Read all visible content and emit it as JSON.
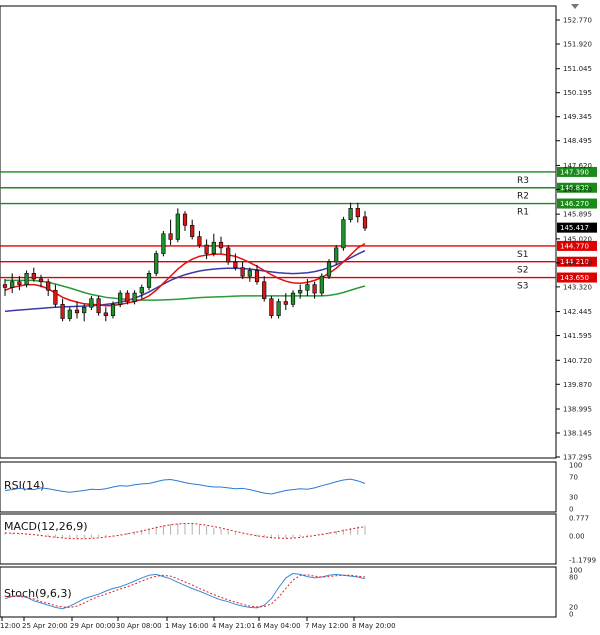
{
  "chart_data": {
    "type": "candlestick",
    "price_axis_labels": [
      "152.770",
      "151.920",
      "151.045",
      "150.195",
      "149.345",
      "148.495",
      "147.620",
      "146.770",
      "145.895",
      "145.020",
      "144.170",
      "143.320",
      "142.445",
      "141.595",
      "140.720",
      "139.870",
      "138.995",
      "138.145",
      "137.295"
    ],
    "price_range": [
      137.295,
      152.77
    ],
    "current_price": "145.417",
    "time_labels": [
      "12:00",
      "25 Apr 20:00",
      "29 Apr 00:00",
      "30 Apr 08:00",
      "1 May 16:00",
      "4 May 21:01",
      "6 May 04:00",
      "7 May 12:00",
      "8 May 20:00"
    ],
    "candles": [
      [
        143.4,
        143.6,
        143.0,
        143.3
      ],
      [
        143.3,
        143.8,
        143.1,
        143.5
      ],
      [
        143.5,
        143.7,
        143.2,
        143.4
      ],
      [
        143.4,
        143.9,
        143.3,
        143.8
      ],
      [
        143.8,
        144.0,
        143.5,
        143.6
      ],
      [
        143.6,
        143.75,
        143.3,
        143.5
      ],
      [
        143.5,
        143.6,
        143.0,
        143.2
      ],
      [
        143.2,
        143.4,
        142.6,
        142.7
      ],
      [
        142.7,
        142.9,
        142.1,
        142.2
      ],
      [
        142.2,
        142.6,
        142.1,
        142.5
      ],
      [
        142.5,
        142.8,
        142.2,
        142.4
      ],
      [
        142.4,
        142.7,
        142.1,
        142.6
      ],
      [
        142.6,
        143.0,
        142.5,
        142.9
      ],
      [
        142.9,
        143.0,
        142.3,
        142.4
      ],
      [
        142.4,
        142.6,
        142.1,
        142.3
      ],
      [
        142.3,
        142.8,
        142.2,
        142.7
      ],
      [
        142.7,
        143.2,
        142.6,
        143.1
      ],
      [
        143.1,
        143.2,
        142.7,
        142.8
      ],
      [
        142.8,
        143.2,
        142.7,
        143.1
      ],
      [
        143.1,
        143.4,
        142.9,
        143.3
      ],
      [
        143.3,
        143.9,
        143.2,
        143.8
      ],
      [
        143.8,
        144.6,
        143.7,
        144.5
      ],
      [
        144.5,
        145.3,
        144.4,
        145.2
      ],
      [
        145.2,
        145.7,
        144.8,
        145.0
      ],
      [
        145.0,
        146.1,
        144.9,
        145.9
      ],
      [
        145.9,
        146.0,
        145.3,
        145.5
      ],
      [
        145.5,
        145.7,
        145.0,
        145.1
      ],
      [
        145.1,
        145.3,
        144.7,
        144.8
      ],
      [
        144.8,
        145.0,
        144.3,
        144.5
      ],
      [
        144.5,
        145.2,
        144.4,
        144.9
      ],
      [
        144.9,
        145.1,
        144.5,
        144.7
      ],
      [
        144.7,
        144.8,
        144.1,
        144.2
      ],
      [
        144.2,
        144.5,
        143.9,
        144.0
      ],
      [
        144.0,
        144.2,
        143.6,
        143.7
      ],
      [
        143.7,
        144.0,
        143.5,
        143.9
      ],
      [
        143.9,
        144.1,
        143.4,
        143.5
      ],
      [
        143.5,
        143.7,
        142.8,
        142.9
      ],
      [
        142.9,
        143.0,
        142.2,
        142.3
      ],
      [
        142.3,
        142.9,
        142.2,
        142.8
      ],
      [
        142.8,
        143.1,
        142.5,
        142.7
      ],
      [
        142.7,
        143.2,
        142.6,
        143.1
      ],
      [
        143.1,
        143.4,
        142.9,
        143.2
      ],
      [
        143.2,
        143.6,
        143.0,
        143.4
      ],
      [
        143.4,
        143.5,
        142.9,
        143.1
      ],
      [
        143.1,
        143.8,
        143.0,
        143.7
      ],
      [
        143.7,
        144.3,
        143.6,
        144.2
      ],
      [
        144.2,
        144.8,
        144.1,
        144.7
      ],
      [
        144.7,
        145.8,
        144.6,
        145.7
      ],
      [
        145.7,
        146.3,
        145.6,
        146.1
      ],
      [
        146.1,
        146.3,
        145.6,
        145.8
      ],
      [
        145.8,
        146.0,
        145.3,
        145.4
      ]
    ],
    "ma_fast": [
      143.2,
      143.3,
      143.35,
      143.4,
      143.4,
      143.35,
      143.25,
      143.1,
      142.95,
      142.85,
      142.78,
      142.72,
      142.7,
      142.68,
      142.65,
      142.66,
      142.7,
      142.75,
      142.8,
      142.88,
      143.0,
      143.2,
      143.45,
      143.7,
      143.95,
      144.15,
      144.3,
      144.4,
      144.45,
      144.48,
      144.48,
      144.45,
      144.4,
      144.3,
      144.18,
      144.05,
      143.9,
      143.75,
      143.62,
      143.52,
      143.46,
      143.45,
      143.48,
      143.55,
      143.65,
      143.8,
      143.98,
      144.2,
      144.45,
      144.7,
      144.85
    ],
    "ma_mid": [
      143.55,
      143.55,
      143.55,
      143.55,
      143.55,
      143.52,
      143.48,
      143.42,
      143.35,
      143.28,
      143.2,
      143.12,
      143.05,
      143.0,
      142.95,
      142.92,
      142.9,
      142.88,
      142.86,
      142.85,
      142.85,
      142.85,
      142.86,
      142.87,
      142.88,
      142.9,
      142.92,
      142.94,
      142.95,
      142.96,
      142.97,
      142.98,
      142.99,
      143.0,
      143.0,
      143.0,
      143.0,
      143.0,
      143.0,
      143.0,
      143.0,
      143.0,
      143.0,
      143.0,
      143.0,
      143.02,
      143.06,
      143.12,
      143.2,
      143.28,
      143.35
    ],
    "ma_slow": [
      142.45,
      142.48,
      142.5,
      142.52,
      142.54,
      142.56,
      142.58,
      142.6,
      142.61,
      142.62,
      142.63,
      142.64,
      142.65,
      142.67,
      142.7,
      142.73,
      142.78,
      142.84,
      142.92,
      143.02,
      143.14,
      143.28,
      143.42,
      143.55,
      143.66,
      143.75,
      143.82,
      143.88,
      143.92,
      143.95,
      143.97,
      143.98,
      143.98,
      143.97,
      143.95,
      143.92,
      143.88,
      143.85,
      143.82,
      143.8,
      143.79,
      143.8,
      143.82,
      143.86,
      143.92,
      144.0,
      144.1,
      144.22,
      144.35,
      144.48,
      144.6
    ],
    "levels": [
      {
        "name": "R3",
        "value": 147.39,
        "label": "147.390",
        "color": "#1a8a1a"
      },
      {
        "name": "R2",
        "value": 146.83,
        "label": "146.830",
        "color": "#1a8a1a"
      },
      {
        "name": "R1",
        "value": 146.27,
        "label": "146.270",
        "color": "#1a8a1a"
      },
      {
        "name": "S1",
        "value": 144.77,
        "label": "144.770",
        "color": "#e00000"
      },
      {
        "name": "S2",
        "value": 144.21,
        "label": "144.210",
        "color": "#e00000"
      },
      {
        "name": "S3",
        "value": 143.65,
        "label": "143.650",
        "color": "#e00000"
      }
    ],
    "rsi": {
      "label": "RSI(14)",
      "axis": [
        "100",
        "70",
        "30",
        "0"
      ],
      "values": [
        42,
        44,
        47,
        45,
        44,
        48,
        46,
        43,
        40,
        38,
        40,
        42,
        45,
        44,
        46,
        50,
        53,
        52,
        55,
        57,
        58,
        62,
        66,
        67,
        64,
        60,
        57,
        55,
        52,
        50,
        50,
        48,
        46,
        47,
        44,
        40,
        36,
        34,
        38,
        42,
        44,
        46,
        45,
        48,
        53,
        57,
        62,
        66,
        68,
        64,
        58
      ]
    },
    "macd": {
      "label": "MACD(12,26,9)",
      "axis": [
        "0.777",
        "0.00",
        "-1.1799"
      ],
      "hist": [
        0.1,
        0.08,
        0.05,
        0.02,
        -0.02,
        -0.05,
        -0.1,
        -0.14,
        -0.18,
        -0.2,
        -0.2,
        -0.18,
        -0.15,
        -0.12,
        -0.08,
        -0.03,
        0.02,
        0.08,
        0.15,
        0.22,
        0.3,
        0.38,
        0.45,
        0.5,
        0.52,
        0.53,
        0.5,
        0.46,
        0.4,
        0.33,
        0.26,
        0.18,
        0.1,
        0.03,
        -0.04,
        -0.1,
        -0.15,
        -0.18,
        -0.19,
        -0.18,
        -0.15,
        -0.11,
        -0.06,
        0.0,
        0.06,
        0.12,
        0.18,
        0.25,
        0.32,
        0.38,
        0.42
      ],
      "signal": [
        0.08,
        0.07,
        0.06,
        0.03,
        0.0,
        -0.04,
        -0.08,
        -0.12,
        -0.15,
        -0.18,
        -0.19,
        -0.19,
        -0.17,
        -0.15,
        -0.11,
        -0.07,
        -0.02,
        0.04,
        0.1,
        0.17,
        0.25,
        0.33,
        0.4,
        0.46,
        0.5,
        0.52,
        0.52,
        0.49,
        0.44,
        0.38,
        0.31,
        0.23,
        0.15,
        0.08,
        0.01,
        -0.05,
        -0.1,
        -0.14,
        -0.16,
        -0.17,
        -0.16,
        -0.13,
        -0.09,
        -0.04,
        0.01,
        0.07,
        0.13,
        0.19,
        0.26,
        0.32,
        0.37
      ]
    },
    "stoch": {
      "label": "Stoch(9,6,3)",
      "axis": [
        "100",
        "80",
        "20",
        "0"
      ],
      "k": [
        35,
        40,
        42,
        38,
        30,
        25,
        20,
        15,
        12,
        18,
        26,
        35,
        40,
        45,
        52,
        58,
        62,
        68,
        75,
        82,
        88,
        90,
        85,
        80,
        72,
        65,
        58,
        52,
        45,
        38,
        32,
        28,
        22,
        18,
        15,
        14,
        20,
        35,
        60,
        82,
        92,
        90,
        85,
        82,
        84,
        88,
        90,
        88,
        86,
        84,
        80
      ],
      "d": [
        40,
        40,
        40,
        38,
        34,
        28,
        24,
        19,
        16,
        15,
        18,
        25,
        33,
        40,
        45,
        51,
        57,
        62,
        68,
        75,
        81,
        86,
        88,
        86,
        80,
        73,
        66,
        58,
        51,
        44,
        38,
        32,
        27,
        22,
        18,
        16,
        17,
        23,
        38,
        58,
        77,
        88,
        89,
        86,
        84,
        85,
        87,
        88,
        88,
        86,
        84
      ]
    }
  }
}
